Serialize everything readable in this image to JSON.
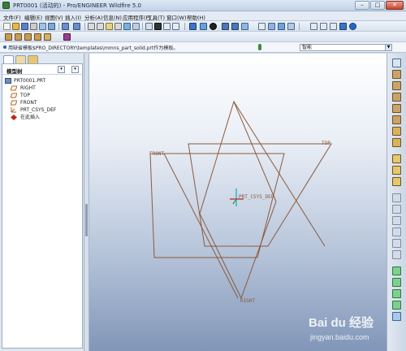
{
  "window": {
    "title": "PRT0001 (活动的) - Pro/ENGINEER Wildfire 5.0",
    "min_glyph": "–",
    "max_glyph": "□",
    "close_glyph": "✕"
  },
  "menu": [
    "文件(F)",
    "编辑(E)",
    "视图(V)",
    "插入(I)",
    "分析(A)",
    "信息(N)",
    "应用程序(P)",
    "工具(T)",
    "窗口(W)",
    "帮助(H)"
  ],
  "message_bar": {
    "text": "用缺省模板$PRO_DIRECTORY\\templates\\mmns_part_solid.prt作为模板。",
    "filter_value": "智能"
  },
  "model_tree": {
    "title": "模型树",
    "items": [
      {
        "label": "PRT0001.PRT",
        "icon": "part-icon"
      },
      {
        "label": "RIGHT",
        "icon": "datum-plane-icon"
      },
      {
        "label": "TOP",
        "icon": "datum-plane-icon"
      },
      {
        "label": "FRONT",
        "icon": "datum-plane-icon"
      },
      {
        "label": "PRT_CSYS_DEF",
        "icon": "coordinate-system-icon"
      },
      {
        "label": "在此插入",
        "icon": "insert-here-icon"
      }
    ]
  },
  "viewport": {
    "datum_labels": {
      "front": "FRONT",
      "top": "TOP",
      "right": "RIGHT",
      "csys": "PRT_CSYS_DEF"
    },
    "datum_color": "#8b5a3c"
  },
  "watermark": {
    "brand": "Bai du 经验",
    "url": "jingyan.baidu.com"
  }
}
